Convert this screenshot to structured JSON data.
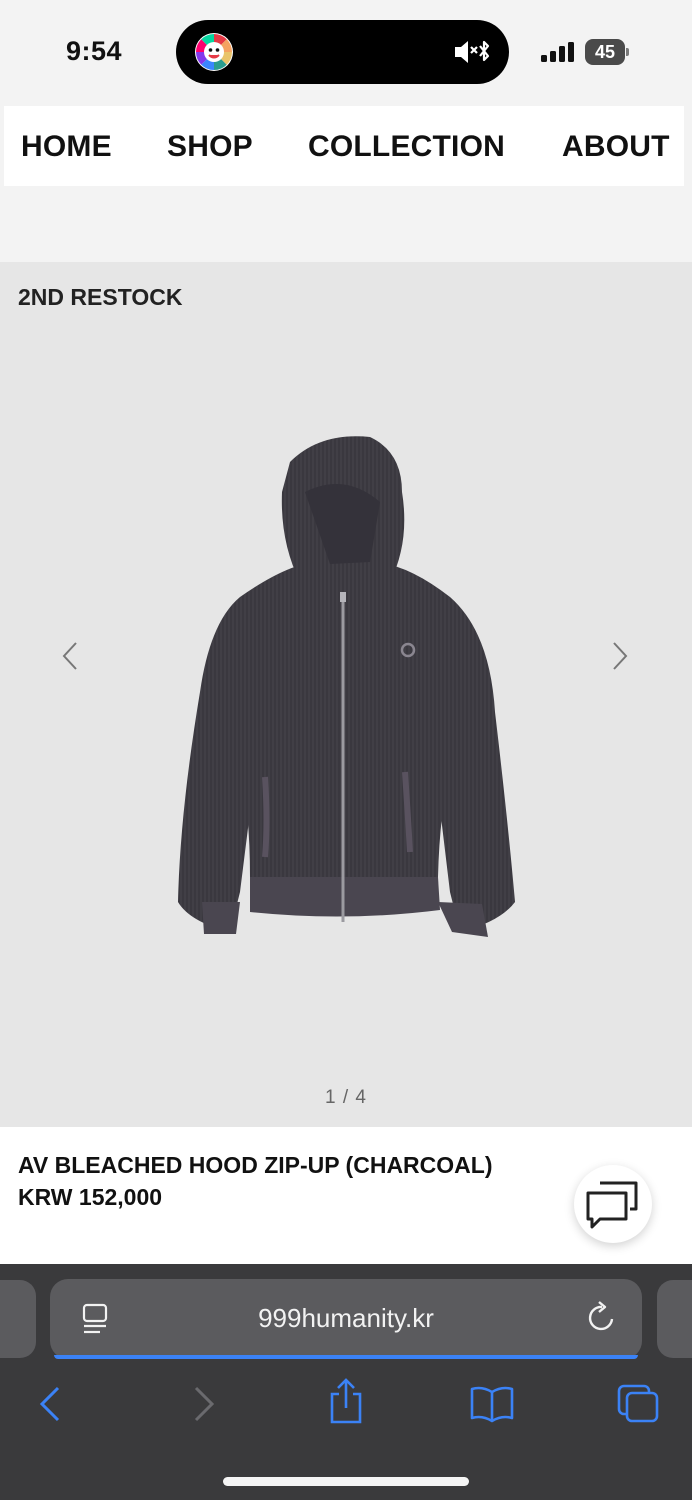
{
  "status_bar": {
    "time": "9:54",
    "battery": "45",
    "icons": [
      "flower-app-icon",
      "speaker-mute-icon",
      "bluetooth-icon",
      "signal-icon",
      "battery-icon"
    ]
  },
  "nav": {
    "items": [
      {
        "label": "HOME"
      },
      {
        "label": "SHOP"
      },
      {
        "label": "COLLECTION"
      },
      {
        "label": "ABOUT"
      }
    ]
  },
  "product": {
    "badge": "2ND RESTOCK",
    "name": "AV BLEACHED HOOD ZIP-UP (CHARCOAL)",
    "price": "KRW 152,000",
    "pager": "1 / 4",
    "image_icon": "hoodie-product-image"
  },
  "safari": {
    "url": "999humanity.kr",
    "icons": [
      "reader-icon",
      "reload-icon",
      "back-icon",
      "forward-icon",
      "share-icon",
      "bookmarks-icon",
      "tabs-icon"
    ]
  },
  "colors": {
    "accent_blue": "#3b82f6",
    "safari_bg": "#3a3a3c",
    "gallery_bg": "#e6e6e6",
    "hoodie": "#3f3f44"
  }
}
